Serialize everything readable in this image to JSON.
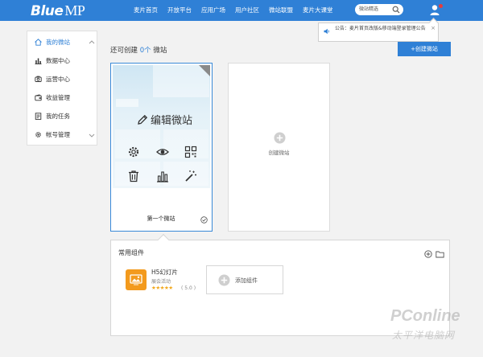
{
  "colors": {
    "brand": "#2f80d6",
    "accent_orange": "#f39a1d",
    "star": "#f2a81c",
    "alert_dot": "#e63c3c"
  },
  "header": {
    "logo": {
      "word": "Blue",
      "suffix": "MP"
    },
    "nav": [
      "麦片首页",
      "开放平台",
      "应用广场",
      "用户社区",
      "微站联盟",
      "麦片大课堂"
    ],
    "search": {
      "text": "微站精选",
      "icon": "search-icon"
    },
    "user_icon": "user-icon"
  },
  "notice": {
    "text": "公告：麦片首页改版&移动端登录管理公告",
    "close": "×",
    "icon": "speaker-icon"
  },
  "sidebar": {
    "items": [
      {
        "label": "我的微站",
        "icon": "home-icon"
      },
      {
        "label": "数据中心",
        "icon": "bar-chart-icon"
      },
      {
        "label": "运营中心",
        "icon": "operation-icon"
      },
      {
        "label": "收益管理",
        "icon": "wallet-icon"
      },
      {
        "label": "我的任务",
        "icon": "task-icon"
      },
      {
        "label": "帐号管理",
        "icon": "gear-icon"
      }
    ]
  },
  "main": {
    "heading_prefix": "还可创建",
    "heading_count": "0个",
    "heading_suffix": "微站",
    "create_button": "+创建微站",
    "site_card": {
      "edit_label": "编辑微站",
      "name": "第一个微站"
    },
    "create_card": {
      "label": "创建微站"
    }
  },
  "components": {
    "title": "常用组件",
    "items": [
      {
        "name": "H5幻灯片",
        "subtitle": "展会活动",
        "stars": "★★★★★",
        "rating": "( 5.0 )"
      }
    ],
    "add_label": "添加组件"
  },
  "watermark": {
    "brand": "PConline",
    "sub": "太平洋电脑网"
  }
}
